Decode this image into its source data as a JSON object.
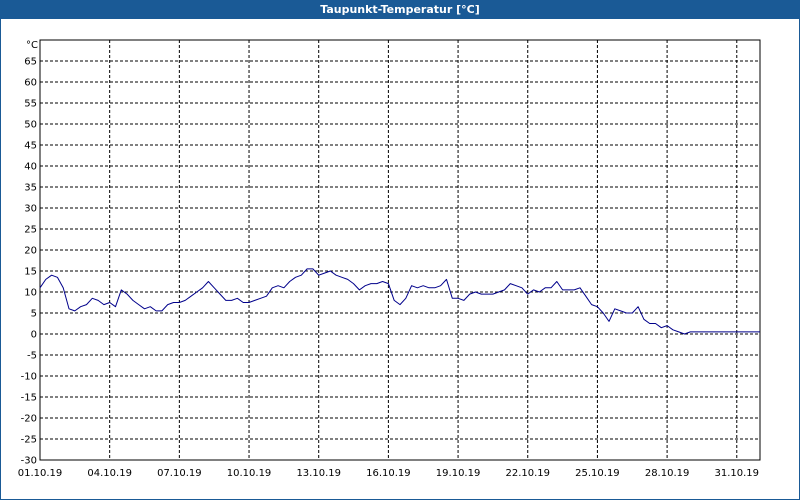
{
  "window": {
    "title": "Taupunkt-Temperatur [°C]"
  },
  "colors": {
    "title_bar": "#1a5a96",
    "series": "#00008b",
    "grid": "#000000"
  },
  "chart_data": {
    "type": "line",
    "title": "Taupunkt-Temperatur [°C]",
    "ylabel": "°C",
    "ylim": [
      -30,
      70
    ],
    "yticks": [
      -30,
      -25,
      -20,
      -15,
      -10,
      -5,
      0,
      5,
      10,
      15,
      20,
      25,
      30,
      35,
      40,
      45,
      50,
      55,
      60,
      65
    ],
    "xlim": [
      "01.10.19",
      "01.11.19"
    ],
    "xticks": [
      "01.10.19",
      "04.10.19",
      "07.10.19",
      "10.10.19",
      "13.10.19",
      "16.10.19",
      "19.10.19",
      "22.10.19",
      "25.10.19",
      "28.10.19",
      "31.10.19"
    ],
    "grid": true,
    "series": [
      {
        "x": [
          "01.10.19 00:00",
          "01.10.19 06:00",
          "01.10.19 12:00",
          "01.10.19 18:00",
          "02.10.19 00:00",
          "02.10.19 06:00",
          "02.10.19 12:00",
          "02.10.19 18:00",
          "03.10.19 00:00",
          "03.10.19 06:00",
          "03.10.19 12:00",
          "03.10.19 18:00",
          "04.10.19 00:00",
          "04.10.19 06:00",
          "04.10.19 12:00",
          "04.10.19 18:00",
          "05.10.19 00:00",
          "05.10.19 06:00",
          "05.10.19 12:00",
          "05.10.19 18:00",
          "06.10.19 00:00",
          "06.10.19 06:00",
          "06.10.19 12:00",
          "06.10.19 18:00",
          "07.10.19 00:00",
          "07.10.19 06:00",
          "07.10.19 12:00",
          "07.10.19 18:00",
          "08.10.19 00:00",
          "08.10.19 06:00",
          "08.10.19 12:00",
          "08.10.19 18:00",
          "09.10.19 00:00",
          "09.10.19 06:00",
          "09.10.19 12:00",
          "09.10.19 18:00",
          "10.10.19 00:00",
          "10.10.19 06:00",
          "10.10.19 12:00",
          "10.10.19 18:00",
          "11.10.19 00:00",
          "11.10.19 06:00",
          "11.10.19 12:00",
          "11.10.19 18:00",
          "12.10.19 00:00",
          "12.10.19 06:00",
          "12.10.19 12:00",
          "12.10.19 18:00",
          "13.10.19 00:00",
          "13.10.19 06:00",
          "13.10.19 12:00",
          "13.10.19 18:00",
          "14.10.19 00:00",
          "14.10.19 06:00",
          "14.10.19 12:00",
          "14.10.19 18:00",
          "15.10.19 00:00",
          "15.10.19 06:00",
          "15.10.19 12:00",
          "15.10.19 18:00",
          "16.10.19 00:00",
          "16.10.19 06:00",
          "16.10.19 12:00",
          "16.10.19 18:00",
          "17.10.19 00:00",
          "17.10.19 06:00",
          "17.10.19 12:00",
          "17.10.19 18:00",
          "18.10.19 00:00",
          "18.10.19 06:00",
          "18.10.19 12:00",
          "18.10.19 18:00",
          "19.10.19 00:00",
          "19.10.19 06:00",
          "19.10.19 12:00",
          "19.10.19 18:00",
          "20.10.19 00:00",
          "20.10.19 06:00",
          "20.10.19 12:00",
          "20.10.19 18:00",
          "21.10.19 00:00",
          "21.10.19 06:00",
          "21.10.19 12:00",
          "21.10.19 18:00",
          "22.10.19 00:00",
          "22.10.19 06:00",
          "22.10.19 12:00",
          "22.10.19 18:00",
          "23.10.19 00:00",
          "23.10.19 06:00",
          "23.10.19 12:00",
          "23.10.19 18:00",
          "24.10.19 00:00",
          "24.10.19 06:00",
          "24.10.19 12:00",
          "24.10.19 18:00",
          "25.10.19 00:00",
          "25.10.19 06:00",
          "25.10.19 12:00",
          "25.10.19 18:00",
          "26.10.19 00:00",
          "26.10.19 06:00",
          "26.10.19 12:00",
          "26.10.19 18:00",
          "27.10.19 00:00",
          "27.10.19 06:00",
          "27.10.19 12:00",
          "27.10.19 18:00",
          "28.10.19 00:00",
          "28.10.19 06:00",
          "28.10.19 12:00",
          "28.10.19 18:00",
          "29.10.19 00:00",
          "29.10.19 06:00",
          "29.10.19 12:00",
          "29.10.19 18:00",
          "30.10.19 00:00",
          "30.10.19 06:00",
          "30.10.19 12:00",
          "30.10.19 18:00",
          "31.10.19 00:00",
          "31.10.19 06:00",
          "31.10.19 12:00",
          "31.10.19 18:00",
          "01.11.19 00:00"
        ],
        "values": [
          11.0,
          13.0,
          14.0,
          13.5,
          11.0,
          6.0,
          5.5,
          6.5,
          7.0,
          8.5,
          8.0,
          7.0,
          7.5,
          6.5,
          10.5,
          9.5,
          8.0,
          7.0,
          6.0,
          6.5,
          5.5,
          5.5,
          7.0,
          7.5,
          7.5,
          8.0,
          9.0,
          10.0,
          11.0,
          12.5,
          11.0,
          9.5,
          8.0,
          8.0,
          8.5,
          7.5,
          7.5,
          8.0,
          8.5,
          9.0,
          11.0,
          11.5,
          11.0,
          12.5,
          13.5,
          14.0,
          15.5,
          15.5,
          14.0,
          14.5,
          15.0,
          14.0,
          13.5,
          13.0,
          12.0,
          10.5,
          11.5,
          12.0,
          12.0,
          12.5,
          12.0,
          8.0,
          7.0,
          8.5,
          11.5,
          11.0,
          11.5,
          11.0,
          11.0,
          11.5,
          13.0,
          8.5,
          8.5,
          8.0,
          9.5,
          10.0,
          9.5,
          9.5,
          9.5,
          10.0,
          10.5,
          12.0,
          11.5,
          11.0,
          9.5,
          10.5,
          10.0,
          11.0,
          11.0,
          12.5,
          10.5,
          10.5,
          10.5,
          11.0,
          9.0,
          7.0,
          6.5,
          5.0,
          3.0,
          6.0,
          5.5,
          5.0,
          5.0,
          6.5,
          3.5,
          2.5,
          2.5,
          1.5,
          2.0,
          1.0,
          0.5,
          0.0,
          0.5,
          0.5,
          0.5,
          0.5,
          0.5,
          0.5,
          0.5,
          0.5,
          0.5,
          0.5,
          0.5,
          0.5,
          0.5
        ]
      }
    ]
  }
}
